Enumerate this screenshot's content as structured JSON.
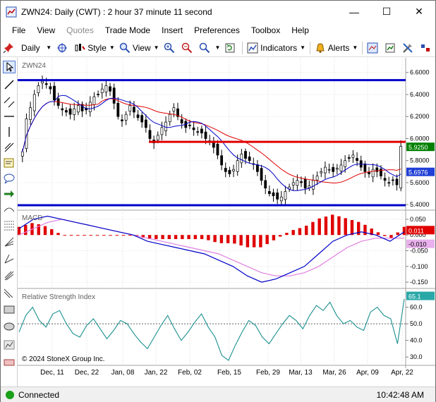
{
  "window": {
    "title": "ZWN24: Daily (CWT) : 2 hour 37 minute 11 second",
    "minimize_glyph": "—",
    "maximize_glyph": "☐",
    "close_glyph": "✕"
  },
  "menu": [
    "File",
    "View",
    "Quotes",
    "Trade Mode",
    "Insert",
    "Preferences",
    "Toolbox",
    "Help"
  ],
  "menu_disabled": [
    "Quotes"
  ],
  "toolbar": {
    "period": "Daily",
    "style_label": "Style",
    "view_label": "View",
    "indicators_label": "Indicators",
    "alerts_label": "Alerts"
  },
  "price_panel": {
    "symbol_label": "ZWN24",
    "y_ticks": [
      "6.6000",
      "6.4000",
      "6.2000",
      "6.0000",
      "5.8000",
      "5.6000",
      "5.4000"
    ],
    "last_price_badge": "5.9250",
    "ma_badge": "5.6976",
    "colors": {
      "blue_line": "#0000c8",
      "red_line": "#e00000",
      "up_candle": "#ffffff",
      "down_candle": "#000000",
      "badge_green": "#008000",
      "badge_blue": "#1f3fd6"
    }
  },
  "macd_panel": {
    "label": "MACD",
    "y_ticks": [
      "0.050",
      "0.000",
      "-0.050",
      "-0.100",
      "-0.150"
    ],
    "badge_red": "0.011",
    "badge_lilac": "-0.010",
    "colors": {
      "macd_line": "#0000c8",
      "signal_line": "#e080e0",
      "histogram": "#e00000"
    }
  },
  "rsi_panel": {
    "label": "Relative Strength Index",
    "y_ticks": [
      "60.0",
      "50.0",
      "40.0",
      "30.0"
    ],
    "rsi_badge": "65.1",
    "copyright": "© 2024 StoneX Group Inc."
  },
  "x_axis_labels": [
    "Dec, 11",
    "Dec, 22",
    "Jan, 08",
    "Jan, 22",
    "Feb, 02",
    "Feb, 15",
    "Feb, 29",
    "Mar, 13",
    "Mar, 26",
    "Apr, 09",
    "Apr, 22"
  ],
  "status": {
    "connection": "Connected",
    "time": "10:42:48 AM"
  },
  "chart_data": [
    {
      "type": "candlestick",
      "title": "ZWN24",
      "y_range": [
        5.35,
        6.72
      ],
      "horizontal_levels": [
        {
          "price": 6.53,
          "color": "blue"
        },
        {
          "price": 5.97,
          "color": "red"
        },
        {
          "price": 5.395,
          "color": "blue"
        }
      ],
      "close": [
        5.88,
        6.18,
        6.28,
        6.4,
        6.48,
        6.52,
        6.49,
        6.45,
        6.35,
        6.3,
        6.26,
        6.24,
        6.22,
        6.27,
        6.3,
        6.25,
        6.26,
        6.33,
        6.38,
        6.4,
        6.45,
        6.48,
        6.43,
        6.32,
        6.2,
        6.16,
        6.22,
        6.3,
        6.24,
        6.19,
        6.15,
        6.1,
        6.0,
        5.96,
        6.03,
        6.1,
        6.15,
        6.22,
        6.28,
        6.2,
        6.14,
        6.1,
        6.12,
        6.08,
        6.06,
        6.05,
        6.0,
        5.98,
        5.92,
        5.85,
        5.76,
        5.7,
        5.68,
        5.72,
        5.8,
        5.86,
        5.82,
        5.8,
        5.77,
        5.7,
        5.62,
        5.55,
        5.5,
        5.48,
        5.45,
        5.47,
        5.52,
        5.56,
        5.6,
        5.62,
        5.6,
        5.55,
        5.57,
        5.62,
        5.66,
        5.7,
        5.74,
        5.72,
        5.7,
        5.73,
        5.76,
        5.8,
        5.82,
        5.85,
        5.8,
        5.74,
        5.7,
        5.68,
        5.72,
        5.7,
        5.66,
        5.62,
        5.6,
        5.62,
        5.58,
        5.93
      ],
      "ma_blue_end": 5.6976,
      "last_price": 5.925
    },
    {
      "type": "line",
      "title": "MACD",
      "y_range": [
        -0.17,
        0.07
      ],
      "series": [
        {
          "name": "MACD",
          "values": [
            0.02,
            0.05,
            0.06,
            0.05,
            0.04,
            0.03,
            0.02,
            0.01,
            0.0,
            -0.02,
            -0.03,
            -0.04,
            -0.05,
            -0.06,
            -0.08,
            -0.1,
            -0.13,
            -0.15,
            -0.14,
            -0.12,
            -0.1,
            -0.06,
            -0.02,
            0.0,
            0.01,
            0.0,
            -0.02,
            0.01
          ]
        },
        {
          "name": "Signal",
          "values": [
            0.0,
            0.02,
            0.04,
            0.05,
            0.04,
            0.03,
            0.02,
            0.01,
            0.0,
            -0.01,
            -0.02,
            -0.03,
            -0.04,
            -0.05,
            -0.06,
            -0.08,
            -0.1,
            -0.12,
            -0.13,
            -0.13,
            -0.12,
            -0.1,
            -0.07,
            -0.04,
            -0.02,
            -0.01,
            -0.01,
            -0.01
          ]
        }
      ],
      "last_values": [
        0.011,
        -0.01
      ]
    },
    {
      "type": "line",
      "title": "Relative Strength Index",
      "y_range": [
        25,
        70
      ],
      "reference_line": 50,
      "series": [
        {
          "name": "RSI",
          "values": [
            45,
            55,
            60,
            52,
            48,
            56,
            58,
            50,
            44,
            42,
            49,
            53,
            47,
            41,
            46,
            52,
            50,
            44,
            39,
            35,
            42,
            49,
            55,
            47,
            40,
            45,
            51,
            56,
            48,
            42,
            31,
            28,
            37,
            45,
            52,
            49,
            42,
            38,
            44,
            50,
            55,
            52,
            47,
            55,
            61,
            58,
            63,
            55,
            50,
            52,
            48,
            46,
            57,
            60,
            55,
            53,
            38,
            65
          ]
        }
      ],
      "last_value": 65.1
    }
  ]
}
